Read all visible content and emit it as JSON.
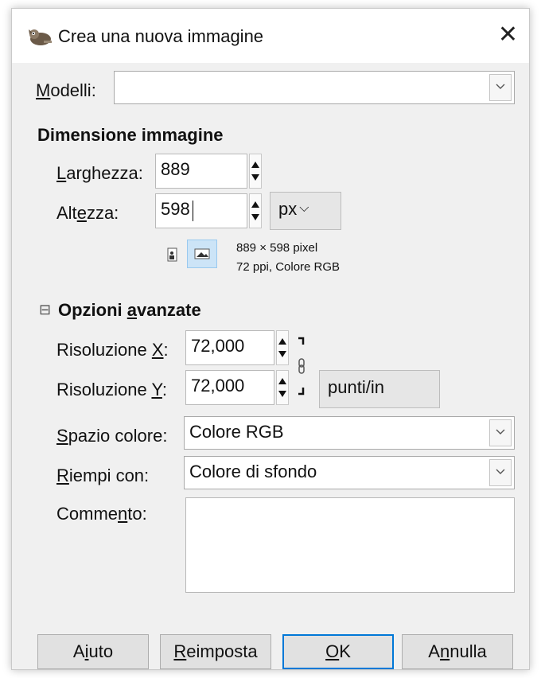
{
  "window": {
    "title": "Crea una nuova immagine",
    "close_glyph": "✕",
    "icon": "gimp-wilber-icon"
  },
  "template": {
    "label_u": "M",
    "label_rest": "odelli:",
    "value": ""
  },
  "image_size": {
    "heading": "Dimensione immagine",
    "width_label_u": "L",
    "width_label_rest": "arghezza:",
    "width_value": "889",
    "height_label_pre": "Alt",
    "height_label_u": "e",
    "height_label_rest": "zza:",
    "height_value": "598",
    "unit": "px",
    "unit_chevron": "⌵",
    "info_line1": "889 × 598 pixel",
    "info_line2": "72 ppi, Colore RGB",
    "orientation_selected": "landscape"
  },
  "advanced": {
    "toggle_glyph": "⊟",
    "heading_pre": "Opzioni ",
    "heading_u": "a",
    "heading_rest": "vanzate",
    "res_x_label_pre": "Risoluzione ",
    "res_x_label_u": "X",
    "res_x_label_rest": ":",
    "res_x_value": "72,000",
    "res_y_label_pre": "Risoluzione ",
    "res_y_label_u": "Y",
    "res_y_label_rest": ":",
    "res_y_value": "72,000",
    "res_unit": "punti/in",
    "colorspace_label_u": "S",
    "colorspace_label_rest": "pazio colore:",
    "colorspace_value": "Colore RGB",
    "fill_label_u": "R",
    "fill_label_rest": "iempi con:",
    "fill_value": "Colore di sfondo",
    "comment_label_pre": "Comme",
    "comment_label_u": "n",
    "comment_label_rest": "to:",
    "comment_value": ""
  },
  "buttons": {
    "help_pre": "A",
    "help_u": "i",
    "help_rest": "uto",
    "reset_u": "R",
    "reset_rest": "eimposta",
    "ok_u": "O",
    "ok_rest": "K",
    "cancel_pre": "A",
    "cancel_u": "n",
    "cancel_rest": "nulla"
  },
  "colors": {
    "dialog_bg": "#f0f0f0",
    "accent_focus": "#0078d7",
    "selected_orientation_bg": "#cce4f7"
  }
}
